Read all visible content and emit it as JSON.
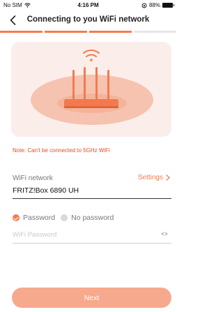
{
  "status_bar": {
    "carrier": "No SIM",
    "time": "4:16 PM",
    "battery": "88%"
  },
  "nav": {
    "back_icon": "chevron-left-icon",
    "title": "Connecting to you WiFi network"
  },
  "progress": {
    "total_steps": 4,
    "completed_steps": 3
  },
  "colors": {
    "accent": "#f47b4f",
    "warning": "#e74c1f",
    "button_disabled": "#f6a98d",
    "illustration_bg": "#fbeeea"
  },
  "illustration": {
    "icon": "wifi-router-icon"
  },
  "note": "Note: Can't be connected to 5GHz WiFi",
  "wifi": {
    "label": "WiFi network",
    "settings_label": "Settings",
    "settings_icon": "chevron-right-icon",
    "network_name": "FRITZ!Box 6890 UH"
  },
  "password": {
    "option_password": "Password",
    "option_no_password": "No password",
    "selected": "Password",
    "placeholder": "WiFi Password",
    "value": "",
    "eye_icon": "eye-icon"
  },
  "next_button": "Next"
}
